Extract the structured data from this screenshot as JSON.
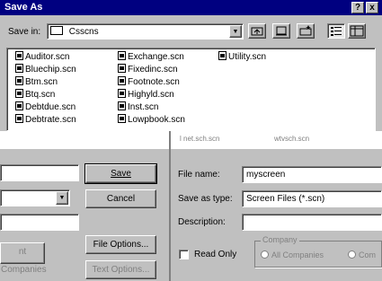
{
  "window": {
    "title": "Save As",
    "help_glyph": "?",
    "close_glyph": "x"
  },
  "save_in": {
    "label": "Save in:",
    "folder": "Csscns"
  },
  "files": {
    "col1": [
      "Auditor.scn",
      "Bluechip.scn",
      "Btm.scn",
      "Btq.scn",
      "Debtdue.scn",
      "Debtrate.scn"
    ],
    "col2": [
      "Exchange.scn",
      "Fixedinc.scn",
      "Footnote.scn",
      "Highyld.scn",
      "Inst.scn",
      "Lowpbook.scn"
    ],
    "col3": [
      "Utility.scn"
    ],
    "faded_row": [
      "l net.sch.scn",
      "wtvsch.scn"
    ]
  },
  "left_panel": {
    "save_label": "Save",
    "cancel_label": "Cancel",
    "file_options_label": "File Options...",
    "text_options_label": "Text Options...",
    "companies_label": "nt Companies"
  },
  "form": {
    "file_name_label": "File name:",
    "file_name_value": "myscreen",
    "save_as_type_label": "Save as type:",
    "save_as_type_value": "Screen Files (*.scn)",
    "description_label": "Description:",
    "description_value": "",
    "read_only_label": "Read Only",
    "company_group_label": "Company",
    "all_companies_label": "All Companies",
    "other_radio_label": "Com"
  }
}
